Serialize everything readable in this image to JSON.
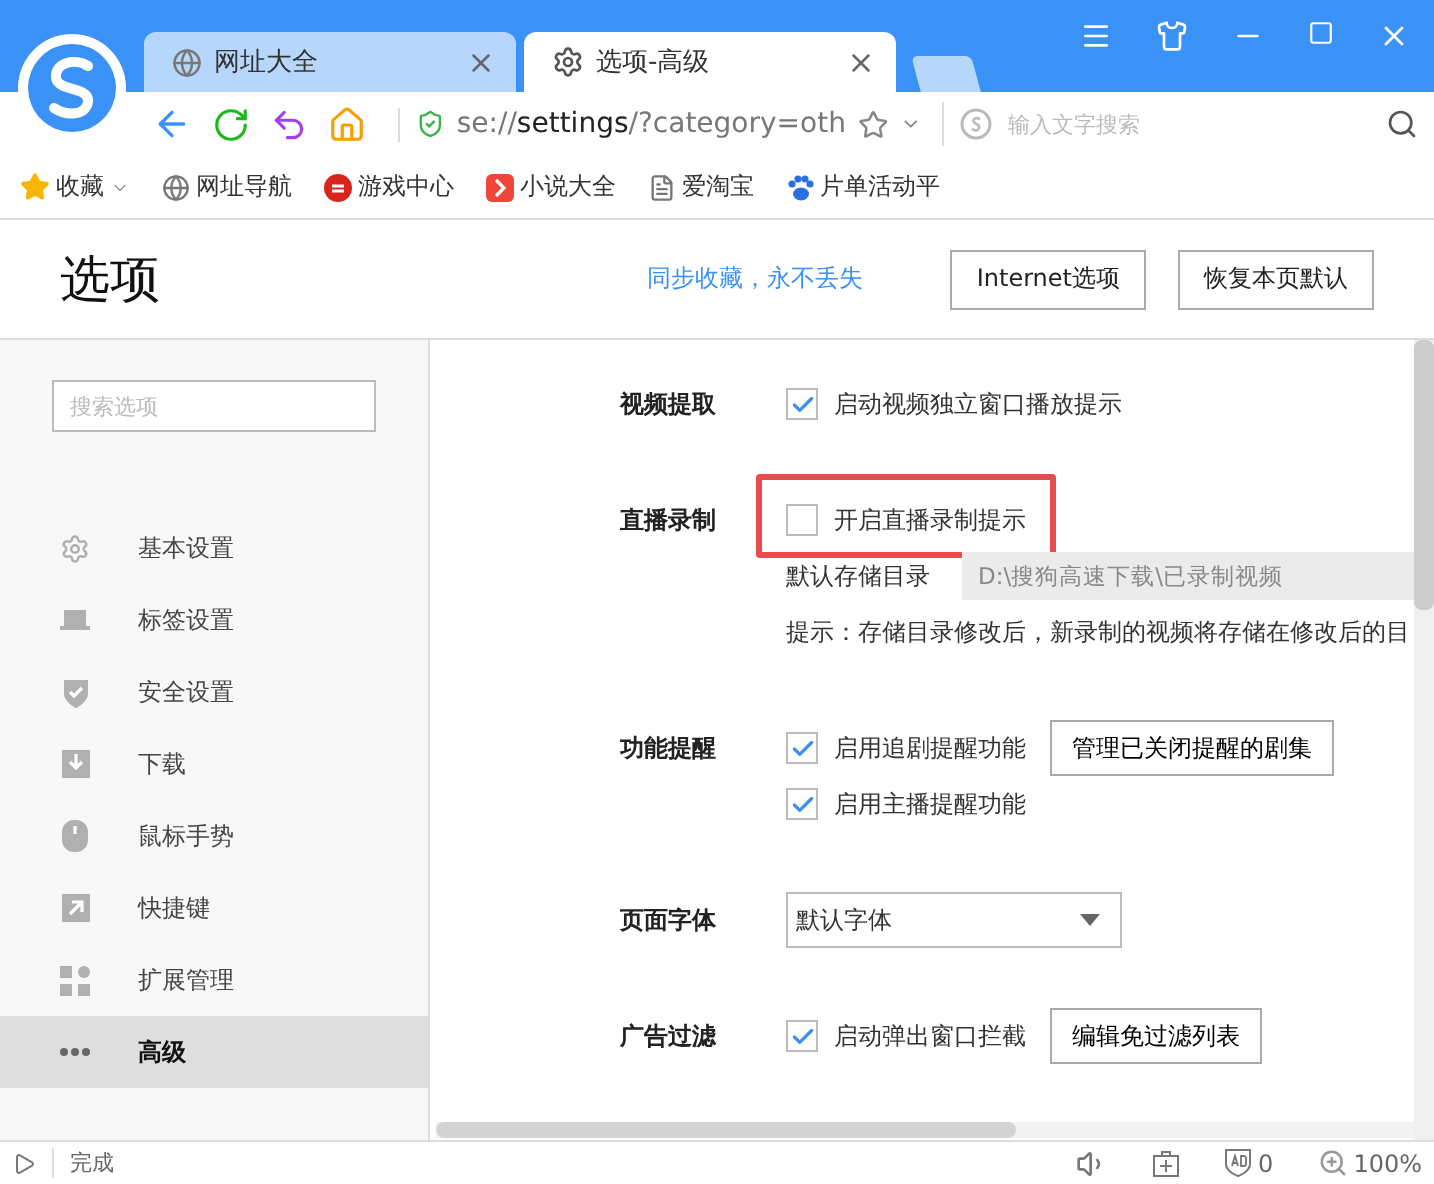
{
  "tabs": [
    {
      "title": "网址大全",
      "kind": "globe",
      "selected": false
    },
    {
      "title": "选项-高级",
      "kind": "gear",
      "selected": true
    }
  ],
  "address": {
    "scheme": "se://",
    "host": "settings",
    "rest": "/?category=oth"
  },
  "search": {
    "placeholder": "输入文字搜索"
  },
  "bookmarks": [
    {
      "label": "收藏",
      "kind": "star"
    },
    {
      "label": "网址导航",
      "kind": "globe"
    },
    {
      "label": "游戏中心",
      "kind": "game"
    },
    {
      "label": "小说大全",
      "kind": "book"
    },
    {
      "label": "爱淘宝",
      "kind": "page"
    },
    {
      "label": "片单活动平",
      "kind": "paw"
    }
  ],
  "page": {
    "title": "选项",
    "sync_link": "同步收藏，永不丢失",
    "buttons": [
      "Internet选项",
      "恢复本页默认"
    ]
  },
  "sidebar": {
    "search_placeholder": "搜索选项",
    "items": [
      {
        "label": "基本设置",
        "kind": "gear",
        "selected": false
      },
      {
        "label": "标签设置",
        "kind": "tab",
        "selected": false
      },
      {
        "label": "安全设置",
        "kind": "shield",
        "selected": false
      },
      {
        "label": "下载",
        "kind": "download",
        "selected": false
      },
      {
        "label": "鼠标手势",
        "kind": "mouse",
        "selected": false
      },
      {
        "label": "快捷键",
        "kind": "shortcut",
        "selected": false
      },
      {
        "label": "扩展管理",
        "kind": "grid",
        "selected": false
      },
      {
        "label": "高级",
        "kind": "dots",
        "selected": true
      }
    ]
  },
  "sections": [
    {
      "label": "视频提取",
      "options": [
        {
          "kind": "checkbox",
          "text": "启动视频独立窗口播放提示",
          "checked": true,
          "highlighted": false
        }
      ]
    },
    {
      "label": "直播录制",
      "options": [
        {
          "kind": "checkbox",
          "text": "开启直播录制提示",
          "checked": false,
          "highlighted": true
        },
        {
          "kind": "field",
          "text": "默认存储目录",
          "value": "D:\\搜狗高速下载\\已录制视频"
        },
        {
          "kind": "hint",
          "text": "提示：存储目录修改后，新录制的视频将存储在修改后的目"
        }
      ]
    },
    {
      "label": "功能提醒",
      "options": [
        {
          "kind": "checkbox",
          "text": "启用追剧提醒功能",
          "checked": true,
          "highlighted": false,
          "button": "管理已关闭提醒的剧集"
        },
        {
          "kind": "checkbox",
          "text": "启用主播提醒功能",
          "checked": true,
          "highlighted": false
        }
      ]
    },
    {
      "label": "页面字体",
      "options": [
        {
          "kind": "dropdown",
          "value": "默认字体"
        }
      ]
    },
    {
      "label": "广告过滤",
      "options": [
        {
          "kind": "checkbox",
          "text": "启动弹出窗口拦截",
          "checked": true,
          "highlighted": false,
          "button": "编辑免过滤列表"
        }
      ]
    }
  ],
  "status": {
    "text": "完成",
    "ad_count": "0",
    "zoom": "100%"
  }
}
